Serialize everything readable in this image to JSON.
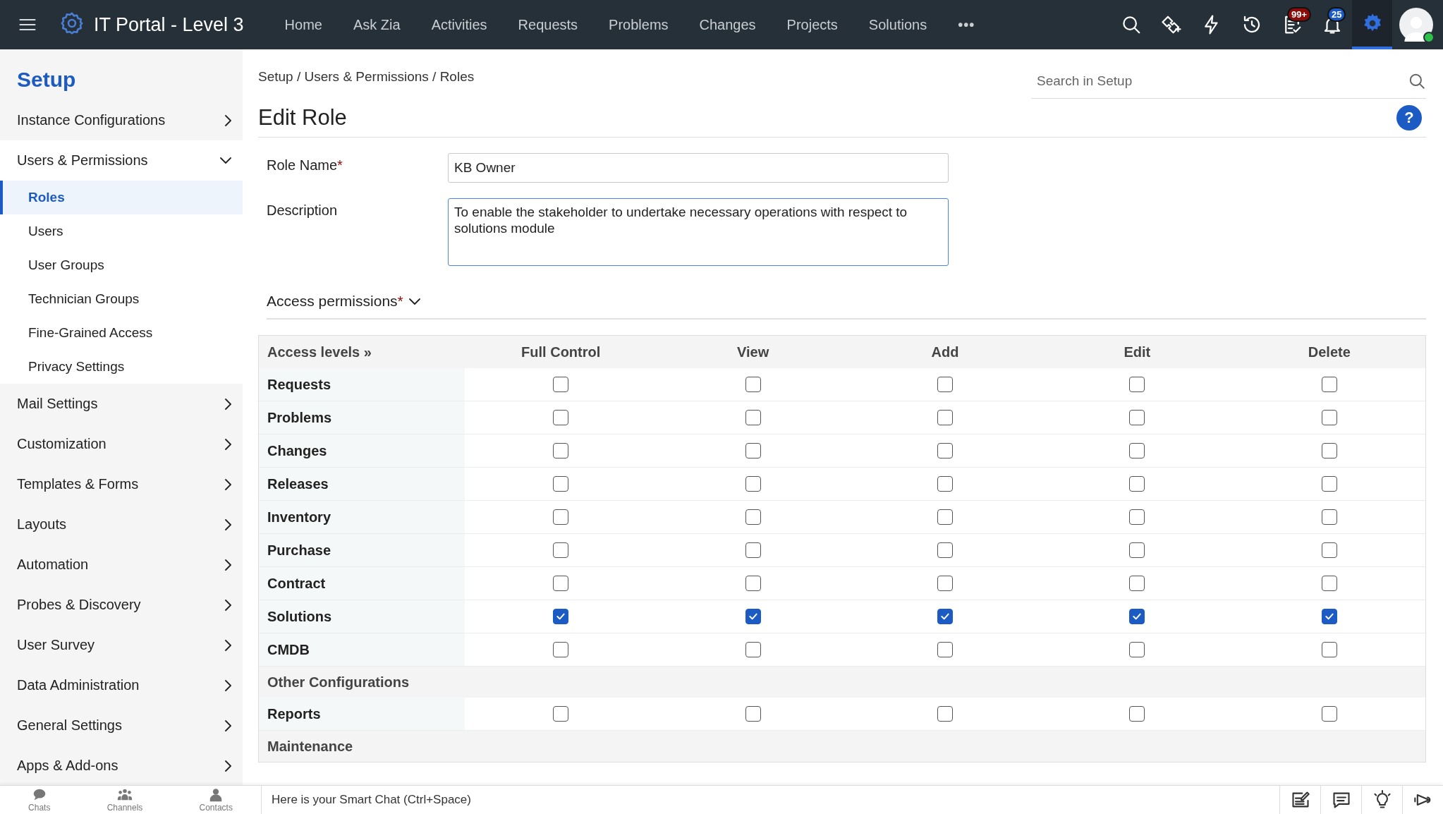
{
  "topbar": {
    "title": "IT Portal - Level 3",
    "nav": [
      {
        "label": "Home"
      },
      {
        "label": "Ask Zia"
      },
      {
        "label": "Activities"
      },
      {
        "label": "Requests"
      },
      {
        "label": "Problems"
      },
      {
        "label": "Changes"
      },
      {
        "label": "Projects"
      },
      {
        "label": "Solutions"
      },
      {
        "label": "•••"
      }
    ],
    "icons": [
      {
        "kind": "search"
      },
      {
        "kind": "ticket"
      },
      {
        "kind": "bolt"
      },
      {
        "kind": "history"
      },
      {
        "kind": "tasks",
        "badge": "99+",
        "color": "#8b0a0a"
      },
      {
        "kind": "bell",
        "badge": "25",
        "color": "#1d5bc4"
      },
      {
        "kind": "gear",
        "selected": true
      },
      {
        "kind": "avatar",
        "online": true
      }
    ]
  },
  "sidebar": {
    "title": "Setup",
    "items": [
      {
        "label": "Instance Configurations",
        "expanded": false
      },
      {
        "label": "Users & Permissions",
        "expanded": true,
        "children": [
          {
            "label": "Roles",
            "selected": true
          },
          {
            "label": "Users",
            "selected": false
          },
          {
            "label": "User Groups",
            "selected": false
          },
          {
            "label": "Technician Groups",
            "selected": false
          },
          {
            "label": "Fine-Grained Access",
            "selected": false
          },
          {
            "label": "Privacy Settings",
            "selected": false
          }
        ]
      },
      {
        "label": "Mail Settings",
        "expanded": false
      },
      {
        "label": "Customization",
        "expanded": false
      },
      {
        "label": "Templates & Forms",
        "expanded": false
      },
      {
        "label": "Layouts",
        "expanded": false
      },
      {
        "label": "Automation",
        "expanded": false
      },
      {
        "label": "Probes & Discovery",
        "expanded": false
      },
      {
        "label": "User Survey",
        "expanded": false
      },
      {
        "label": "Data Administration",
        "expanded": false
      },
      {
        "label": "General Settings",
        "expanded": false
      },
      {
        "label": "Apps & Add-ons",
        "expanded": false
      }
    ]
  },
  "breadcrumb": "Setup / Users & Permissions / Roles",
  "search": {
    "placeholder": "Search in Setup"
  },
  "heading": "Edit Role",
  "help": "?",
  "form": [
    {
      "label": "Role Name",
      "required_mark": "*",
      "kind": "input",
      "value": "KB Owner"
    },
    {
      "label": "Description",
      "kind": "textarea",
      "value": "To enable the stakeholder to undertake necessary operations with respect to solutions module"
    }
  ],
  "permissions": {
    "title": "Access permissions",
    "required_mark": "*",
    "columns": [
      "Access levels »",
      "Full Control",
      "View",
      "Add",
      "Edit",
      "Delete"
    ],
    "rows": [
      {
        "kind": "module",
        "label": "Requests",
        "checks": [
          false,
          false,
          false,
          false,
          false
        ]
      },
      {
        "kind": "module",
        "label": "Problems",
        "checks": [
          false,
          false,
          false,
          false,
          false
        ]
      },
      {
        "kind": "module",
        "label": "Changes",
        "checks": [
          false,
          false,
          false,
          false,
          false
        ]
      },
      {
        "kind": "module",
        "label": "Releases",
        "checks": [
          false,
          false,
          false,
          false,
          false
        ]
      },
      {
        "kind": "module",
        "label": "Inventory",
        "checks": [
          false,
          false,
          false,
          false,
          false
        ]
      },
      {
        "kind": "module",
        "label": "Purchase",
        "checks": [
          false,
          false,
          false,
          false,
          false
        ]
      },
      {
        "kind": "module",
        "label": "Contract",
        "checks": [
          false,
          false,
          false,
          false,
          false
        ]
      },
      {
        "kind": "module",
        "label": "Solutions",
        "checks": [
          true,
          true,
          true,
          true,
          true
        ]
      },
      {
        "kind": "module",
        "label": "CMDB",
        "checks": [
          false,
          false,
          false,
          false,
          false
        ]
      },
      {
        "kind": "section",
        "label": "Other Configurations"
      },
      {
        "kind": "module",
        "label": "Reports",
        "checks": [
          false,
          false,
          false,
          false,
          false
        ]
      },
      {
        "kind": "section",
        "label": "Maintenance"
      }
    ]
  },
  "bottombar": {
    "apps": [
      {
        "kind": "chats",
        "label": "Chats"
      },
      {
        "kind": "channels",
        "label": "Channels"
      },
      {
        "kind": "contacts",
        "label": "Contacts"
      }
    ],
    "chat_placeholder": "Here is your Smart Chat (Ctrl+Space)",
    "tools": [
      {
        "kind": "note"
      },
      {
        "kind": "message"
      },
      {
        "kind": "bulb"
      },
      {
        "kind": "announce"
      }
    ]
  }
}
